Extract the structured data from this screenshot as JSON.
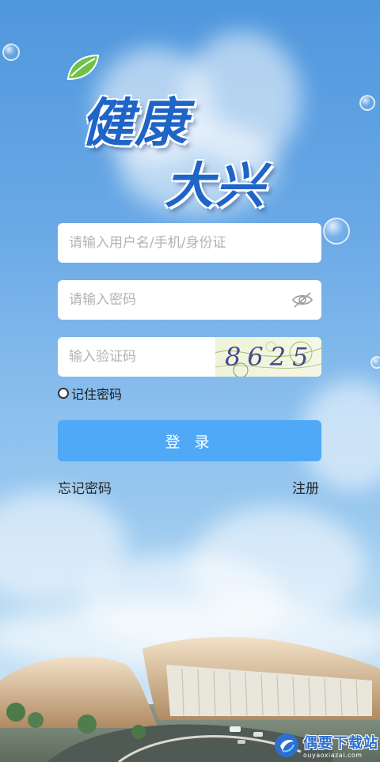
{
  "logo": {
    "line1": "健康",
    "line2": "大兴"
  },
  "form": {
    "username_placeholder": "请输入用户名/手机/身份证",
    "username_value": "",
    "password_placeholder": "请输入密码",
    "password_value": "",
    "captcha_placeholder": "输入验证码",
    "captcha_value": "",
    "captcha_text": "8625"
  },
  "remember": {
    "label": "记住密码",
    "checked": false
  },
  "login_label": "登 录",
  "links": {
    "forgot": "忘记密码",
    "register": "注册"
  },
  "watermark": {
    "title": "偶要下载站",
    "subtitle": "ouyaoxiazai.com"
  },
  "colors": {
    "primary": "#4fa9f7",
    "logo_blue": "#1f64c7",
    "background": "#6aa9e6"
  },
  "icons": {
    "eye": "eye-hidden-icon",
    "checkbox": "checkbox-icon",
    "leaf": "leaf-icon"
  }
}
